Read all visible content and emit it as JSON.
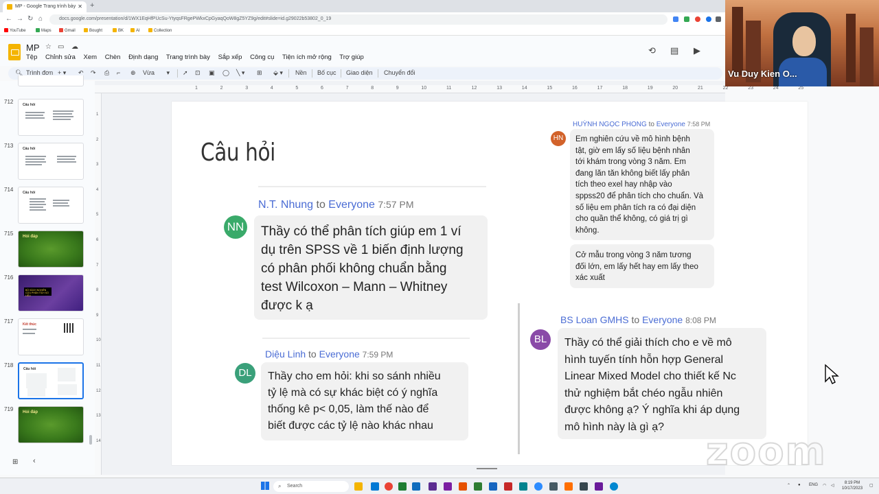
{
  "browser": {
    "tab_title": "MP - Google Trang trình bày",
    "url": "docs.google.com/presentation/d/1WX1EqHfPUcSu-YtyqsFRgePWkxCpGyaqQoW8gZ5YZ9g/edit#slide=id.g29022b53802_0_19",
    "bookmarks": [
      "YouTube",
      "Maps",
      "Gmail",
      "Bought",
      "BK",
      "AI",
      "Collection"
    ]
  },
  "app": {
    "doc_title": "MP",
    "menu": [
      "Tệp",
      "Chỉnh sửa",
      "Xem",
      "Chèn",
      "Định dạng",
      "Trang trình bày",
      "Sắp xếp",
      "Công cụ",
      "Tiện ích mở rộng",
      "Trợ giúp"
    ]
  },
  "toolbar": {
    "search_menus": "Trình đơn",
    "zoom": "Vừa",
    "background": "Nền",
    "layout": "Bố cục",
    "theme": "Giao diện",
    "transition": "Chuyển đổi"
  },
  "filmstrip": {
    "slides": [
      {
        "num": "712",
        "title": "Câu hỏi"
      },
      {
        "num": "713",
        "title": "Câu hỏi"
      },
      {
        "num": "714",
        "title": "Câu hỏi"
      },
      {
        "num": "715",
        "title": "Hỏi đáp"
      },
      {
        "num": "716",
        "title": "BỘ SÁCH NGHIÊN CỨU PHÂN TÍCH SỐ LIỆU"
      },
      {
        "num": "717",
        "title": "Kết thúc"
      },
      {
        "num": "718",
        "title": "Câu hỏi"
      },
      {
        "num": "719",
        "title": "Hỏi đáp"
      }
    ]
  },
  "ruler": {
    "h": [
      "1",
      "2",
      "3",
      "4",
      "5",
      "6",
      "7",
      "8",
      "9",
      "10",
      "11",
      "12",
      "13",
      "14",
      "15",
      "16",
      "17",
      "18",
      "19",
      "20",
      "21",
      "22",
      "23",
      "24",
      "25"
    ],
    "v": [
      "1",
      "2",
      "3",
      "4",
      "5",
      "6",
      "7",
      "8",
      "9",
      "10",
      "11",
      "12",
      "13",
      "14"
    ]
  },
  "slide": {
    "title": "Câu hỏi",
    "messages": [
      {
        "initials": "NN",
        "name": "N.T. Nhung",
        "to": "to",
        "audience": "Everyone",
        "time": "7:57 PM",
        "lines": [
          "Thầy có thể phân tích giúp em 1 ví",
          "dụ trên SPSS về 1 biến định lượng",
          "có phân phối không chuẩn bằng",
          "test Wilcoxon – Mann – Whitney",
          "được k ạ"
        ]
      },
      {
        "initials": "DL",
        "name": "Diệu Linh",
        "to": "to",
        "audience": "Everyone",
        "time": "7:59 PM",
        "lines": [
          "Thầy cho em hỏi: khi so sánh nhiều",
          "tỷ lệ mà có sự khác biệt có ý nghĩa",
          "thống kê p< 0,05, làm thế nào để",
          "biết được các tỷ lệ nào khác nhau"
        ]
      },
      {
        "initials": "HN",
        "name": "HUỲNH NGỌC PHONG",
        "to": "to",
        "audience": "Everyone",
        "time": "7:58 PM",
        "lines": [
          "Em nghiên cứu về mô hình bệnh",
          "tật, giờ em lấy số liệu bệnh nhân",
          "tới khám trong vòng 3 năm.  Em",
          "đang lăn tăn không biết lấy phân",
          "tích theo exel hay nhập vào",
          "sppss20 để phân tích cho chuẩn. Và",
          "số liệu em phân tích ra có đại diện",
          "cho quần thể không, có giá trị gì",
          "không."
        ],
        "lines2": [
          "Cở mẫu trong vòng 3 năm tương",
          "đối lớn, em lấy hết hay em lấy theo",
          "xác xuất"
        ]
      },
      {
        "initials": "BL",
        "name": "BS Loan GMHS",
        "to": "to",
        "audience": "Everyone",
        "time": "8:08 PM",
        "lines": [
          "Thầy có thể giải thích cho e về mô",
          "hình tuyến tính hỗn hợp General",
          "Linear Mixed Model cho thiết kế Nc",
          "thử nghiệm bắt chéo ngẫu nhiên",
          "được không ạ? Ý nghĩa khi áp dụng",
          "mô hình này là gì ạ?"
        ]
      }
    ]
  },
  "overlay": {
    "watermark": "zoom",
    "webcam_name": "Vu Duy Kien O..."
  },
  "colors": {
    "nn": "#3aaa6a",
    "dl": "#3aa07a",
    "hn": "#d2622a",
    "bl": "#8a4aa8",
    "accent": "#1a73e8"
  },
  "taskbar": {
    "search_label": "Search",
    "lang": "ENG",
    "time": "8:19 PM",
    "date": "10/17/2023"
  }
}
